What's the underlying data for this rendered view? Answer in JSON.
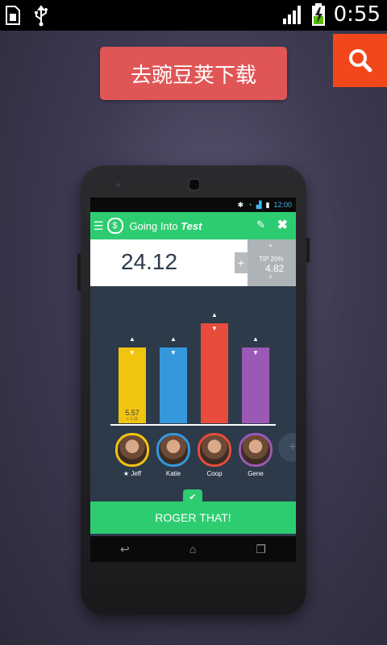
{
  "status_bar": {
    "time": "0:55",
    "icons": [
      "sim-icon",
      "usb-icon",
      "signal-icon",
      "battery-charging-icon"
    ]
  },
  "download_button": {
    "label": "去豌豆荚下载"
  },
  "search_button": {
    "icon": "search-icon",
    "color": "#f2471b"
  },
  "phone": {
    "status_time": "12:00",
    "app_title_prefix": "Going Into ",
    "app_title_emphasis": "Test",
    "amount": "24.12",
    "tip_label": "TIP 20%",
    "tip_value": "4.82",
    "plus": "+",
    "bars": [
      {
        "name": "Jeff",
        "color": "#f1c40f",
        "value": 0.55,
        "label": "5.57",
        "sub": "+ 1.11"
      },
      {
        "name": "Katie",
        "color": "#3498db",
        "value": 0.55,
        "label": "",
        "sub": ""
      },
      {
        "name": "Coop",
        "color": "#e74c3c",
        "value": 0.73,
        "label": "",
        "sub": ""
      },
      {
        "name": "Gene",
        "color": "#9b59b6",
        "value": 0.55,
        "label": "",
        "sub": ""
      }
    ],
    "people": [
      {
        "name": "★ Jeff",
        "ring": "#f1c40f"
      },
      {
        "name": "Katie",
        "ring": "#3498db"
      },
      {
        "name": "Coop",
        "ring": "#e74c3c"
      },
      {
        "name": "Gene",
        "ring": "#9b59b6"
      }
    ],
    "confirm_label": "ROGER THAT!"
  }
}
